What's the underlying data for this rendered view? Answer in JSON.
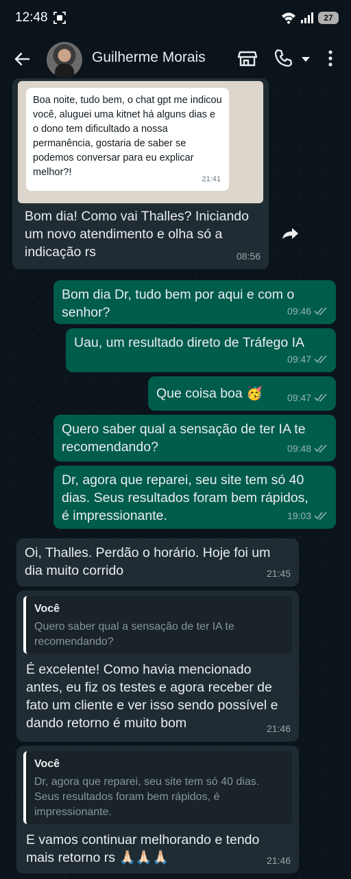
{
  "status": {
    "time": "12:48",
    "battery": "27"
  },
  "header": {
    "contact_name": "Guilherme Morais"
  },
  "forwarded_image": {
    "text": "Boa noite, tudo bem, o chat gpt me indicou você, aluguei uma kitnet há alguns dias e o dono tem dificultado a nossa permanência, gostaria de saber se podemos conversar para eu explicar melhor?!",
    "time": "21:41"
  },
  "messages": [
    {
      "dir": "in",
      "text": "Bom dia! Como vai Thalles? Iniciando um novo atendimento e olha só a indicação rs",
      "time": "08:56"
    },
    {
      "dir": "out",
      "text": "Bom dia Dr, tudo bem por aqui e com o senhor?",
      "time": "09:46"
    },
    {
      "dir": "out",
      "text": "Uau, um resultado direto de Tráfego IA",
      "time": "09:47"
    },
    {
      "dir": "out",
      "text": "Que coisa boa 🥳",
      "time": "09:47"
    },
    {
      "dir": "out",
      "text": "Quero saber qual a sensação de ter IA te recomendando?",
      "time": "09:48"
    },
    {
      "dir": "out",
      "text": "Dr, agora que reparei, seu site tem só 40 dias. Seus resultados foram bem rápidos, é impressionante.",
      "time": "19:03"
    },
    {
      "dir": "in",
      "text": "Oi, Thalles. Perdão o horário. Hoje foi um dia muito corrido",
      "time": "21:45"
    },
    {
      "dir": "in",
      "quote_name": "Você",
      "quote_text": "Quero saber qual a sensação de ter IA te recomendando?",
      "text": "É excelente! Como havia mencionado antes, eu fiz os testes e agora receber de fato um cliente e ver isso sendo possível e dando retorno é muito bom",
      "time": "21:46"
    },
    {
      "dir": "in",
      "quote_name": "Você",
      "quote_text": "Dr, agora que reparei, seu site tem só 40 dias. Seus resultados foram bem rápidos, é impressionante.",
      "text": "E vamos continuar melhorando e tendo mais retorno rs 🙏🏻🙏🏻🙏🏻",
      "time": "21:46"
    }
  ],
  "icons": [
    "back-arrow-icon",
    "store-icon",
    "phone-icon",
    "dropdown-icon",
    "more-options-icon",
    "forward-icon",
    "double-check-icon"
  ],
  "colors": {
    "background": "#0b141a",
    "incoming": "#202c33",
    "outgoing": "#005c4b"
  }
}
